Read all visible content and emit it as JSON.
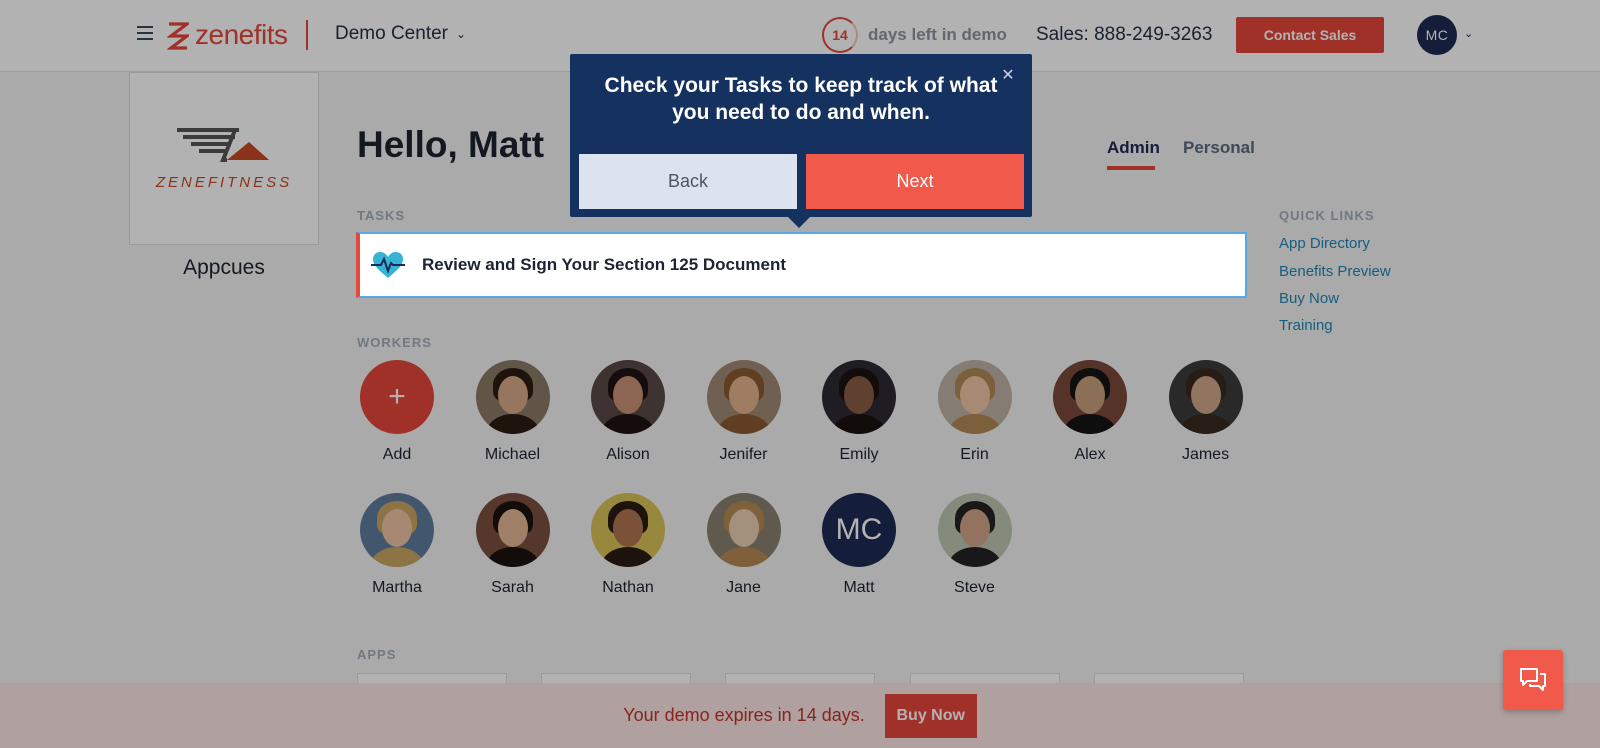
{
  "header": {
    "brand": "zenefits",
    "workspace": "Demo Center",
    "days_left": "14",
    "days_text": "days left in demo",
    "sales": "Sales: 888-249-3263",
    "contact_label": "Contact Sales",
    "user_initials": "MC"
  },
  "company": {
    "logo_text": "ZENEFITNESS",
    "name": "Appcues"
  },
  "greeting": "Hello, Matt",
  "tabs": [
    {
      "label": "Admin",
      "active": true
    },
    {
      "label": "Personal",
      "active": false
    }
  ],
  "tasks": {
    "label": "TASKS",
    "items": [
      {
        "title": "Review and Sign Your Section 125 Document",
        "icon": "heart-pulse-icon"
      }
    ]
  },
  "quick_links": {
    "label": "QUICK LINKS",
    "items": [
      "App Directory",
      "Benefits Preview",
      "Buy Now",
      "Training"
    ]
  },
  "workers": {
    "label": "WORKERS",
    "add_label": "Add",
    "people": [
      {
        "name": "Michael"
      },
      {
        "name": "Alison"
      },
      {
        "name": "Jenifer"
      },
      {
        "name": "Emily"
      },
      {
        "name": "Erin"
      },
      {
        "name": "Alex"
      },
      {
        "name": "James"
      },
      {
        "name": "Martha"
      },
      {
        "name": "Sarah"
      },
      {
        "name": "Nathan"
      },
      {
        "name": "Jane"
      },
      {
        "name": "Matt",
        "initials": "MC"
      },
      {
        "name": "Steve"
      }
    ]
  },
  "apps": {
    "label": "APPS"
  },
  "tooltip": {
    "message": "Check your Tasks to keep track of what you need to do and when.",
    "back_label": "Back",
    "next_label": "Next"
  },
  "banner": {
    "message": "Your demo expires in 14 days.",
    "buy_label": "Buy Now"
  },
  "colors": {
    "brand_red": "#e4473b",
    "navy": "#1d2a52",
    "tooltip_bg": "#15315f",
    "link": "#1f87b8",
    "highlight_border": "#58a8e8"
  }
}
